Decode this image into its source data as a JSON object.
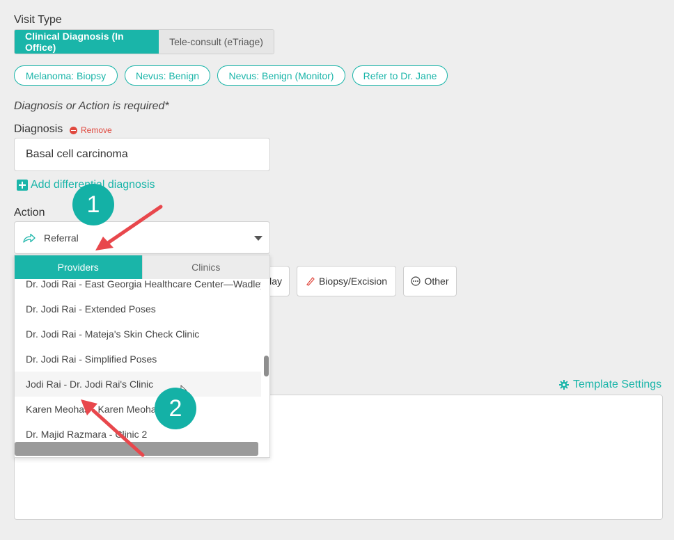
{
  "visit_type": {
    "label": "Visit Type",
    "options": [
      "Clinical Diagnosis (In Office)",
      "Tele-consult (eTriage)"
    ]
  },
  "quick_chips": [
    "Melanoma: Biopsy",
    "Nevus: Benign",
    "Nevus: Benign (Monitor)",
    "Refer to Dr. Jane"
  ],
  "required_note": "Diagnosis or Action is required*",
  "diagnosis": {
    "label": "Diagnosis",
    "remove_label": "Remove",
    "value": "Basal cell carcinoma",
    "add_differential": "Add differential diagnosis"
  },
  "action": {
    "label": "Action",
    "selected": "Referral"
  },
  "action_buttons": {
    "partial_label": "day",
    "biopsy_label": "Biopsy/Excision",
    "other_label": "Other"
  },
  "dropdown": {
    "tabs": [
      "Providers",
      "Clinics"
    ],
    "items": [
      "Dr. Jodi Rai - East Georgia Healthcare Center—Wadley",
      "Dr. Jodi Rai - Extended Poses",
      "Dr. Jodi Rai - Mateja's Skin Check Clinic",
      "Dr. Jodi Rai - Simplified Poses",
      "Jodi Rai - Dr. Jodi Rai's Clinic",
      "Karen Meohas - Karen Meohas",
      "Dr. Majid Razmara - Clinic 2"
    ],
    "hovered_item": "Jodi Rai - Dr. Jodi Rai's Clinic"
  },
  "template_settings": "Template Settings",
  "annotations": {
    "step_1": "1",
    "step_2": "2",
    "accent_color": "#e8474c",
    "badge_color": "#14b1a6"
  },
  "colors": {
    "brand": "#1ab5a9",
    "danger": "#e0483e",
    "background": "#eeeeee"
  }
}
